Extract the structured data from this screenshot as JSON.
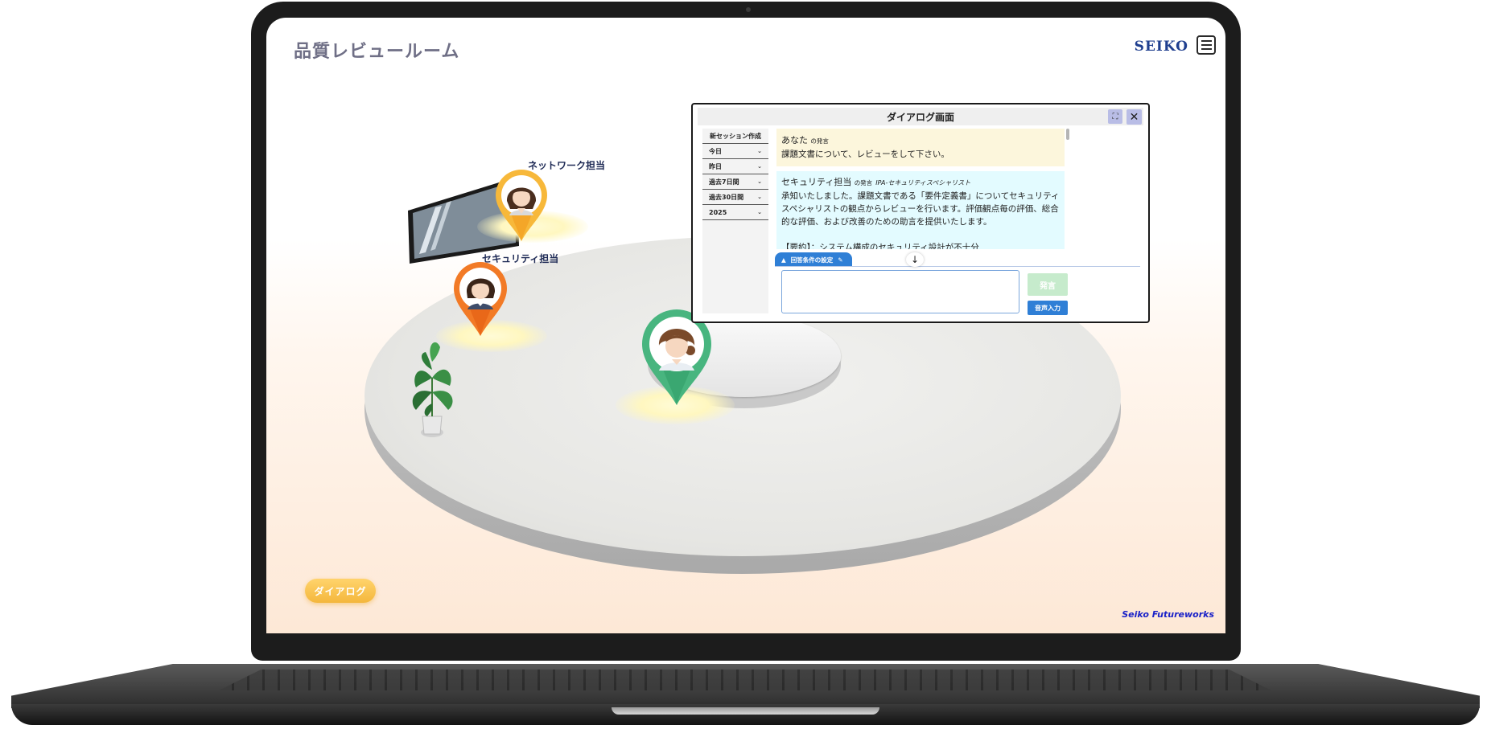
{
  "app": {
    "title": "品質レビュールーム",
    "brand": "SEIKO",
    "footer_brand": "Seiko Futureworks",
    "dialog_button": "ダイアログ"
  },
  "avatars": [
    {
      "label": "ネットワーク担当",
      "color": "#f7b83a",
      "icon": "female-avatar-icon"
    },
    {
      "label": "セキュリティ担当",
      "color": "#f27a26",
      "icon": "female-avatar-icon"
    },
    {
      "label": "",
      "color": "#48b57f",
      "icon": "female-avatar-icon"
    }
  ],
  "dialog": {
    "title": "ダイアログ画面",
    "sidebar": {
      "new_session": "新セッション作成",
      "items": [
        "今日",
        "昨日",
        "過去7日間",
        "過去30日間",
        "2025"
      ]
    },
    "messages": [
      {
        "speaker": "あなた",
        "suffix": "の発言",
        "text": "課題文書について、レビューをして下さい。"
      },
      {
        "speaker": "セキュリティ担当",
        "suffix": "の発言",
        "role": "IPA-セキュリティスペシャリスト",
        "lines": [
          "承知いたしました。課題文書である「要件定義書」についてセキュリティ",
          "スペシャリストの観点からレビューを行います。評価観点毎の評価、総合",
          "的な評価、および改善のための助言を提供いたします。",
          "",
          "【要約】：システム構成のセキュリティ設計が不十分"
        ]
      }
    ],
    "answer_tab": "回答条件の設定",
    "input_value": "",
    "send_label": "発言",
    "voice_label": "音声入力",
    "colors": {
      "accent": "#2f7fd6",
      "user_bubble": "#fcf6dc",
      "ai_bubble": "#e3fbff",
      "send_disabled": "#c6ebcc"
    }
  }
}
